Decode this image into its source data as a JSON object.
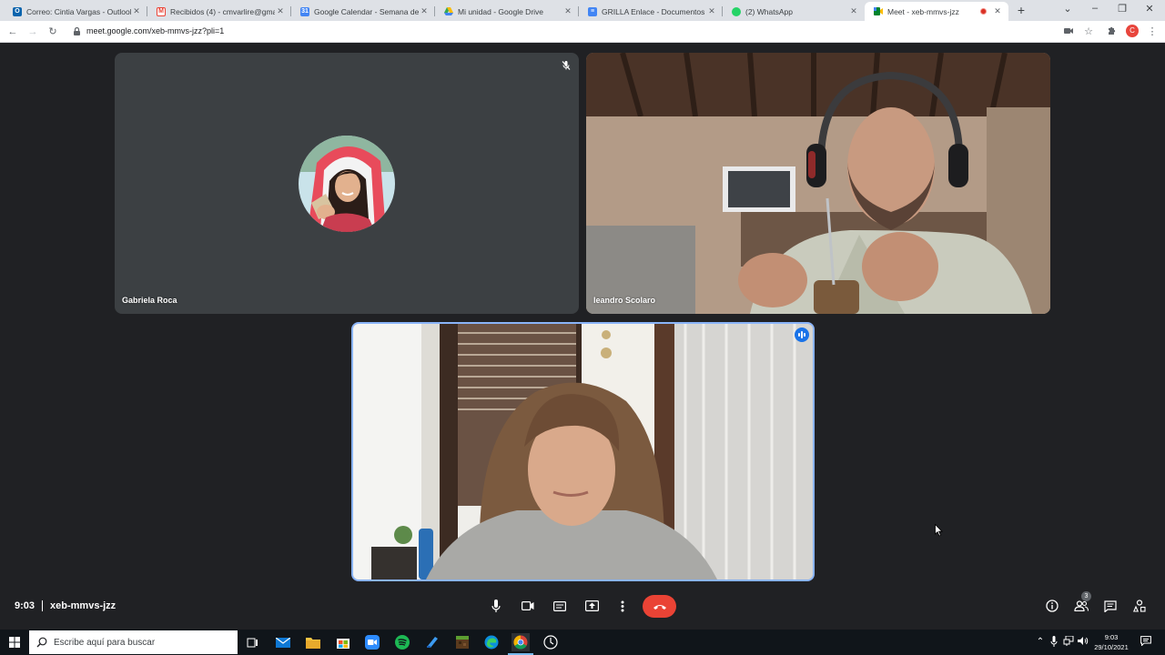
{
  "browser": {
    "tabs": [
      {
        "title": "Correo: Cintia Vargas - Outlook",
        "icon": "outlook-icon",
        "color": "#0a64ad"
      },
      {
        "title": "Recibidos (4) - cmvarlire@gmail",
        "icon": "gmail-icon",
        "color": "#ea4335"
      },
      {
        "title": "Google Calendar - Semana del 2",
        "icon": "calendar-icon",
        "color": "#4285f4"
      },
      {
        "title": "Mi unidad - Google Drive",
        "icon": "drive-icon",
        "color": "#fbbc04"
      },
      {
        "title": "GRILLA Enlace - Documentos de",
        "icon": "docs-icon",
        "color": "#4285f4"
      },
      {
        "title": "(2) WhatsApp",
        "icon": "whatsapp-icon",
        "color": "#25d366"
      },
      {
        "title": "Meet - xeb-mmvs-jzz",
        "icon": "meet-icon",
        "color": "#00832d",
        "active": true
      }
    ],
    "url": "meet.google.com/xeb-mmvs-jzz?pli=1",
    "profile_initial": "C"
  },
  "meet": {
    "participants": [
      {
        "name": "Gabriela Roca",
        "muted": true,
        "camera": "off"
      },
      {
        "name": "leandro Scolaro",
        "muted": false,
        "camera": "on"
      },
      {
        "name": "",
        "speaking": true,
        "camera": "on"
      }
    ],
    "time": "9:03",
    "meeting_code": "xeb-mmvs-jzz",
    "participant_count": "3",
    "colors": {
      "end_call": "#ea4335",
      "speaking": "#1a73e8",
      "background": "#202124"
    }
  },
  "taskbar": {
    "search_placeholder": "Escribe aquí para buscar",
    "clock_time": "9:03",
    "clock_date": "29/10/2021"
  }
}
